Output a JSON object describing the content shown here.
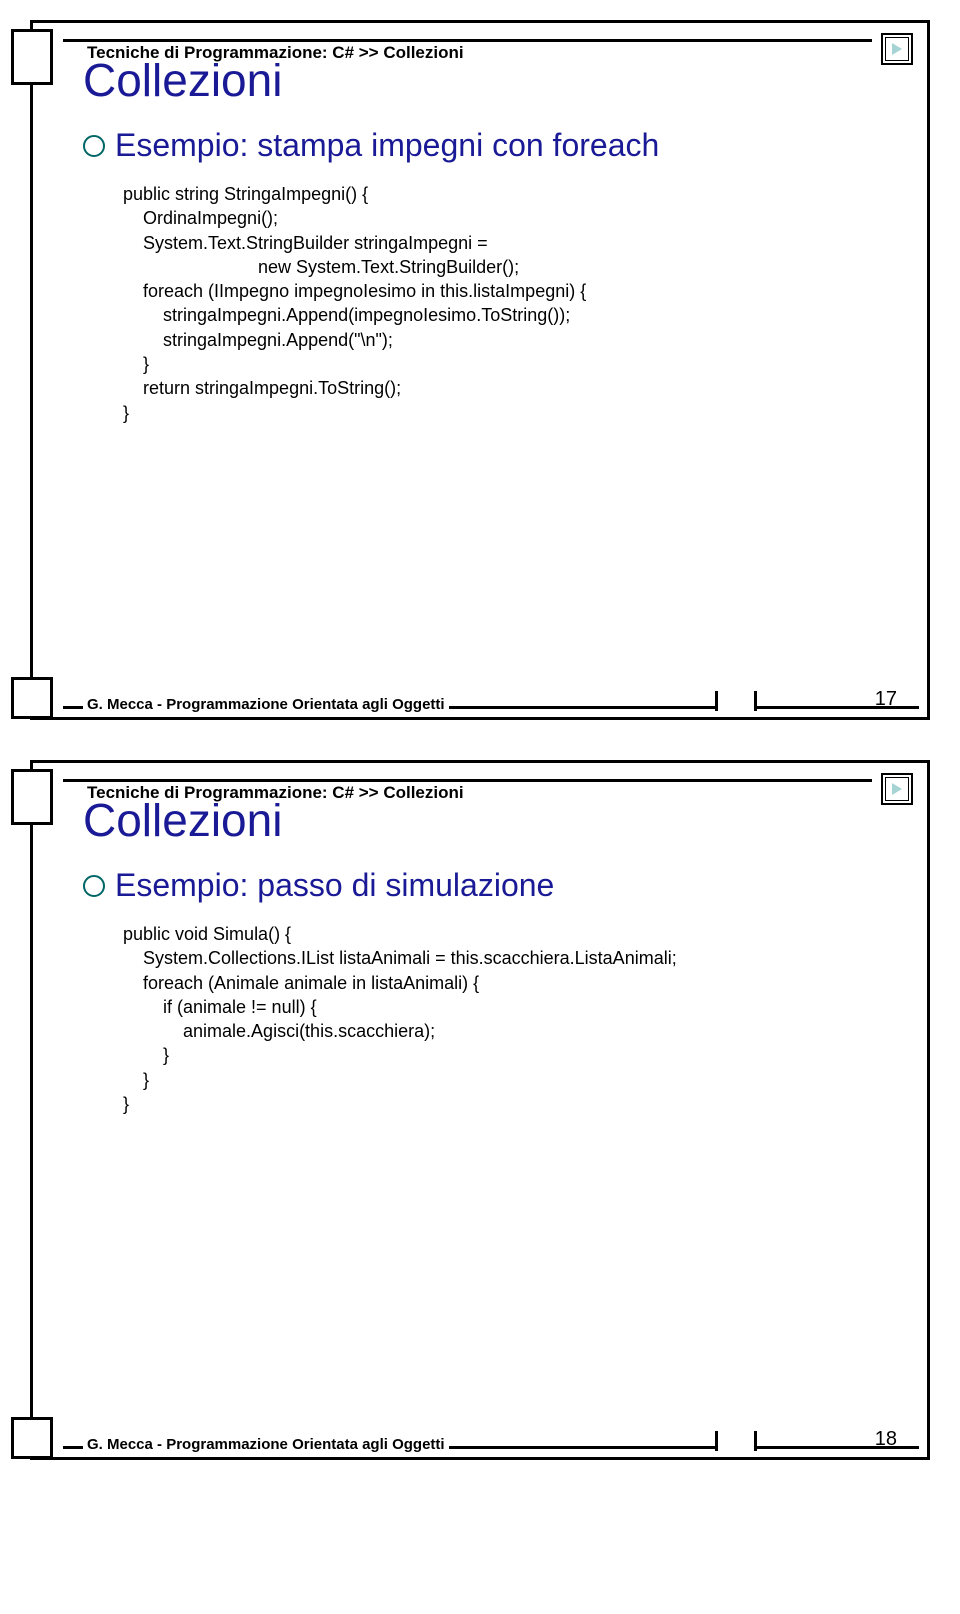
{
  "breadcrumb": "Tecniche di Programmazione: C# >> Collezioni",
  "footer_author": "G. Mecca - Programmazione Orientata agli Oggetti",
  "slide1": {
    "title": "Collezioni",
    "bullet": "Esempio: stampa impegni con foreach",
    "code": "public string StringaImpegni() {\n    OrdinaImpegni();\n    System.Text.StringBuilder stringaImpegni =\n                           new System.Text.StringBuilder();\n    foreach (IImpegno impegnoIesimo in this.listaImpegni) {\n        stringaImpegni.Append(impegnoIesimo.ToString());\n        stringaImpegni.Append(\"\\n\");\n    }\n    return stringaImpegni.ToString();\n}",
    "page": "17"
  },
  "slide2": {
    "title": "Collezioni",
    "bullet": "Esempio: passo di simulazione",
    "code": "public void Simula() {\n    System.Collections.IList listaAnimali = this.scacchiera.ListaAnimali;\n    foreach (Animale animale in listaAnimali) {\n        if (animale != null) {\n            animale.Agisci(this.scacchiera);\n        }\n    }\n}",
    "page": "18"
  }
}
